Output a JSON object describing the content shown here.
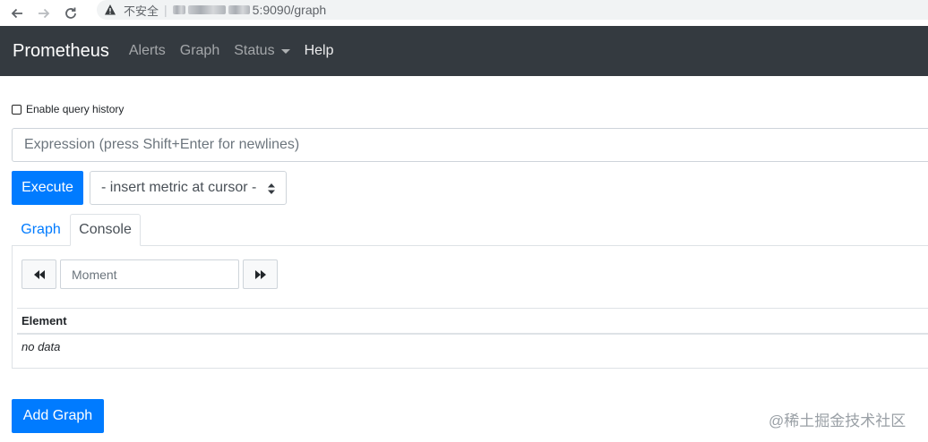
{
  "browser": {
    "insecure_label": "不安全",
    "url_visible": "5:9090/graph",
    "back_icon": "arrow-left-icon",
    "forward_icon": "arrow-right-icon",
    "reload_icon": "reload-icon"
  },
  "navbar": {
    "brand": "Prometheus",
    "links": {
      "alerts": "Alerts",
      "graph": "Graph",
      "status": "Status",
      "help": "Help"
    },
    "bg_color": "#343a40"
  },
  "query": {
    "history_label": "Enable query history",
    "expression_placeholder": "Expression (press Shift+Enter for newlines)",
    "execute_label": "Execute",
    "metric_select": "- insert metric at cursor -"
  },
  "tabs": [
    {
      "label": "Graph",
      "active": false
    },
    {
      "label": "Console",
      "active": true
    }
  ],
  "console": {
    "moment_placeholder": "Moment",
    "table_header": "Element",
    "empty_text": "no data"
  },
  "add_graph_label": "Add Graph",
  "watermark": "@稀土掘金技术社区",
  "colors": {
    "primary": "#007bff",
    "navbar": "#343a40",
    "border": "#dee2e6"
  }
}
